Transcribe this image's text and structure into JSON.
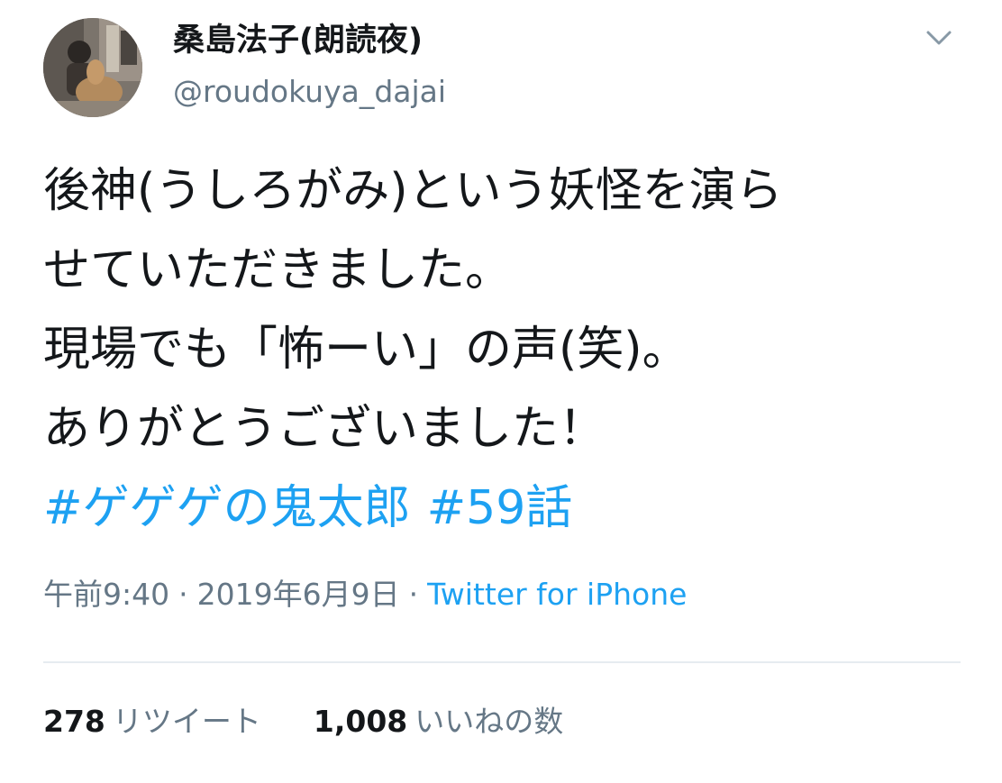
{
  "author": {
    "display_name": "桑島法子(朗読夜)",
    "handle": "@roudokuya_dajai"
  },
  "tweet": {
    "lines": [
      "後神(うしろがみ)という妖怪を演ら",
      "せていただきました。",
      "現場でも「怖ーい」の声(笑)。",
      "ありがとうございました！"
    ],
    "hashtags": [
      "#ゲゲゲの鬼太郎",
      "#59話"
    ]
  },
  "meta": {
    "time": "午前9:40",
    "separator": "·",
    "date": "2019年6月9日",
    "source": "Twitter for iPhone"
  },
  "stats": {
    "retweets_count": "278",
    "retweets_label": "リツイート",
    "likes_count": "1,008",
    "likes_label": "いいねの数"
  },
  "colors": {
    "link": "#1da1f2",
    "secondary_text": "#657786",
    "primary_text": "#14171a",
    "divider": "#e6ecf0"
  },
  "icons": {
    "menu": "chevron-down-icon"
  }
}
